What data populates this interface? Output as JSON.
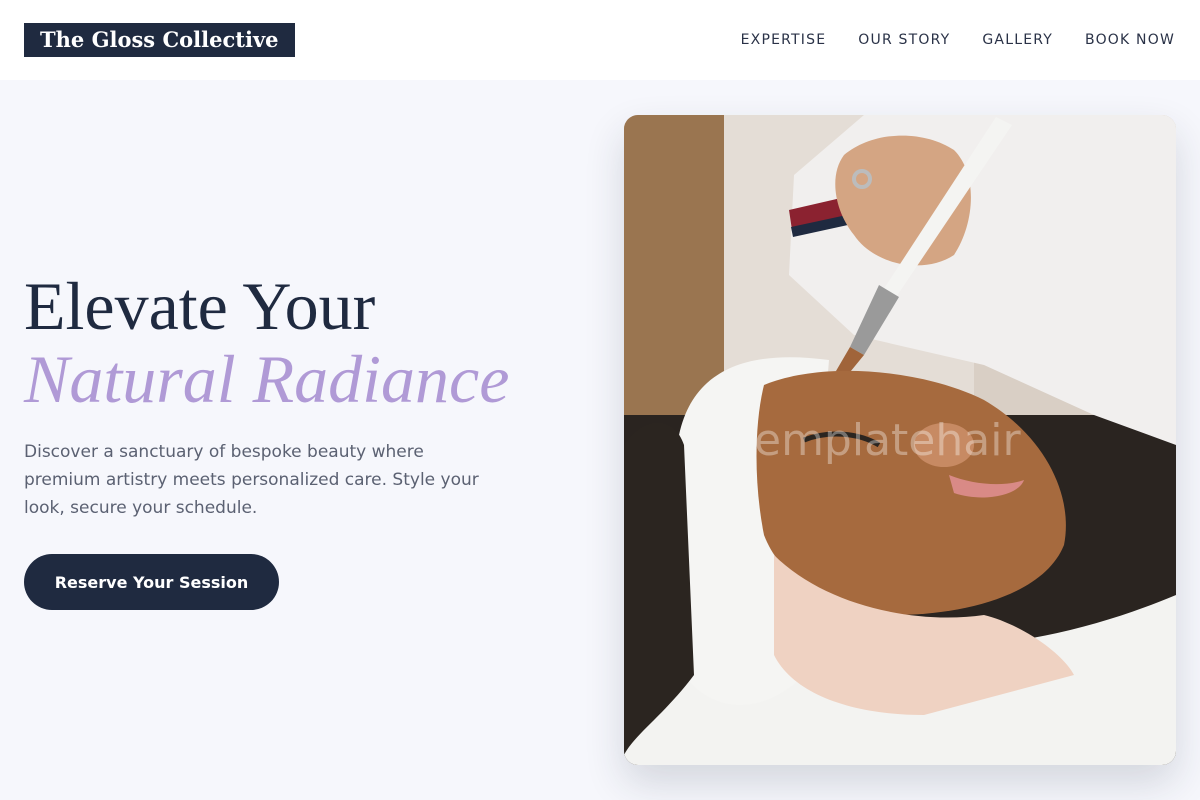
{
  "brand": {
    "name": "The Gloss Collective"
  },
  "nav": {
    "items": [
      "EXPERTISE",
      "OUR STORY",
      "GALLERY",
      "BOOK NOW"
    ]
  },
  "hero": {
    "title_line1": "Elevate Your",
    "title_line2": "Natural Radiance",
    "description": "Discover a sanctuary of bespoke beauty where premium artistry meets personalized care. Style your look, secure your schedule.",
    "cta_label": "Reserve Your Session"
  },
  "image": {
    "subject": "facial-treatment-photo",
    "watermark_text": "emplatehair"
  },
  "colors": {
    "navy": "#1f2a40",
    "lavender": "#b09ad6",
    "background": "#f6f7fc",
    "body_text": "#5b6172"
  }
}
